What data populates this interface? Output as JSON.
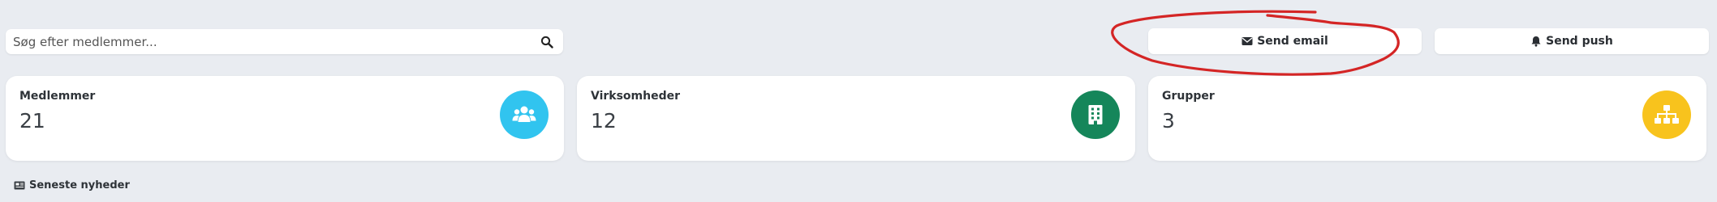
{
  "search": {
    "placeholder": "Søg efter medlemmer...",
    "icon": "search-icon"
  },
  "actions": {
    "send_email": {
      "label": "Send email",
      "icon": "envelope-icon"
    },
    "send_push": {
      "label": "Send push",
      "icon": "bell-icon"
    }
  },
  "stats": {
    "members": {
      "label": "Medlemmer",
      "value": "21",
      "icon": "users-icon",
      "color": "#31c4ef"
    },
    "companies": {
      "label": "Virksomheder",
      "value": "12",
      "icon": "building-icon",
      "color": "#15865a"
    },
    "groups": {
      "label": "Grupper",
      "value": "3",
      "icon": "sitemap-icon",
      "color": "#f8c31d"
    }
  },
  "news": {
    "label": "Seneste nyheder",
    "icon": "newspaper-icon"
  },
  "annotation": {
    "color": "#d42525"
  }
}
